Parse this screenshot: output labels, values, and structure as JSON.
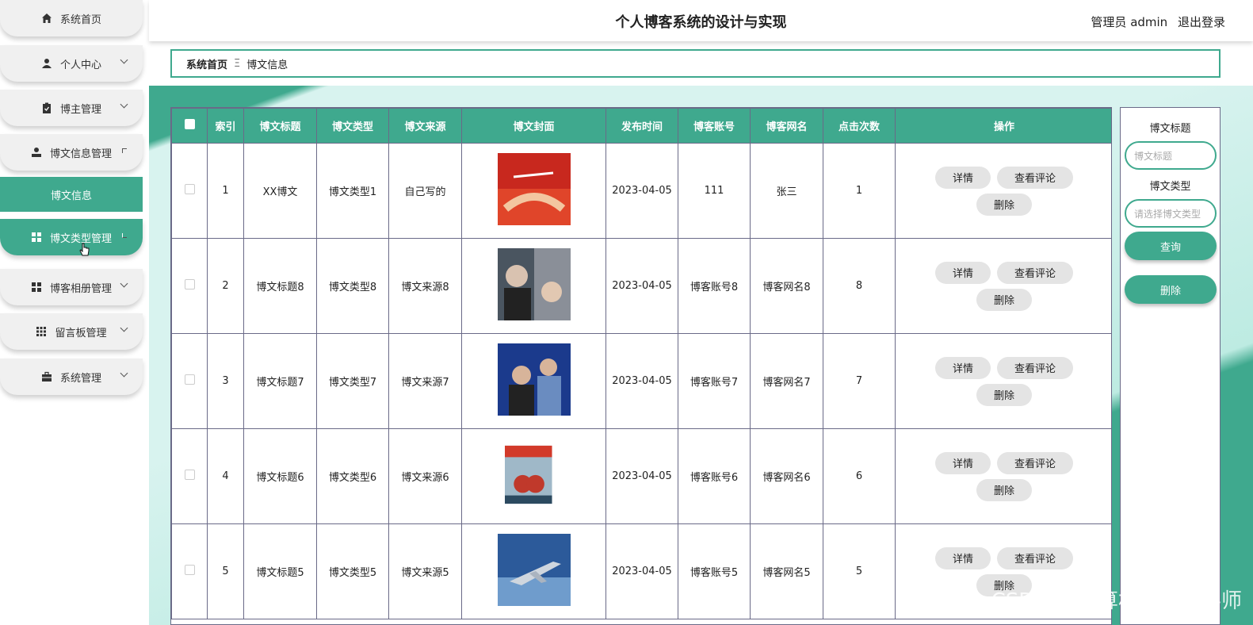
{
  "header": {
    "title": "个人博客系统的设计与实现",
    "user": "管理员 admin",
    "logout": "退出登录"
  },
  "sidebar": {
    "items": [
      {
        "label": "系统首页",
        "icon": "home-icon"
      },
      {
        "label": "个人中心",
        "icon": "user-icon"
      },
      {
        "label": "博主管理",
        "icon": "clipboard-icon"
      },
      {
        "label": "博文信息管理",
        "icon": "person-icon"
      },
      {
        "label": "博文信息",
        "icon": ""
      },
      {
        "label": "博文类型管理",
        "icon": "grid-icon"
      },
      {
        "label": "博客相册管理",
        "icon": "grid-icon"
      },
      {
        "label": "留言板管理",
        "icon": "apps-icon"
      },
      {
        "label": "系统管理",
        "icon": "briefcase-icon"
      }
    ]
  },
  "breadcrumb": {
    "home": "系统首页",
    "separator": "Ξ",
    "current": "博文信息"
  },
  "table": {
    "headers": [
      "索引",
      "博文标题",
      "博文类型",
      "博文来源",
      "博文封面",
      "发布时间",
      "博客账号",
      "博客网名",
      "点击次数",
      "操作"
    ],
    "rows": [
      {
        "index": "1",
        "title": "XX博文",
        "type": "博文类型1",
        "source": "自己写的",
        "date": "2023-04-05",
        "account": "111",
        "nickname": "张三",
        "clicks": "1"
      },
      {
        "index": "2",
        "title": "博文标题8",
        "type": "博文类型8",
        "source": "博文来源8",
        "date": "2023-04-05",
        "account": "博客账号8",
        "nickname": "博客网名8",
        "clicks": "8"
      },
      {
        "index": "3",
        "title": "博文标题7",
        "type": "博文类型7",
        "source": "博文来源7",
        "date": "2023-04-05",
        "account": "博客账号7",
        "nickname": "博客网名7",
        "clicks": "7"
      },
      {
        "index": "4",
        "title": "博文标题6",
        "type": "博文类型6",
        "source": "博文来源6",
        "date": "2023-04-05",
        "account": "博客账号6",
        "nickname": "博客网名6",
        "clicks": "6"
      },
      {
        "index": "5",
        "title": "博文标题5",
        "type": "博文类型5",
        "source": "博文来源5",
        "date": "2023-04-05",
        "account": "博客账号5",
        "nickname": "博客网名5",
        "clicks": "5"
      }
    ],
    "actions": {
      "detail": "详情",
      "comments": "查看评论",
      "delete": "删除"
    }
  },
  "search": {
    "title_label": "博文标题",
    "title_placeholder": "博文标题",
    "type_label": "博文类型",
    "type_placeholder": "请选择博文类型",
    "query_button": "查询",
    "delete_button": "删除"
  },
  "watermark": "CSDN @计算机编程指导师",
  "colors": {
    "accent": "#3fa98e"
  }
}
